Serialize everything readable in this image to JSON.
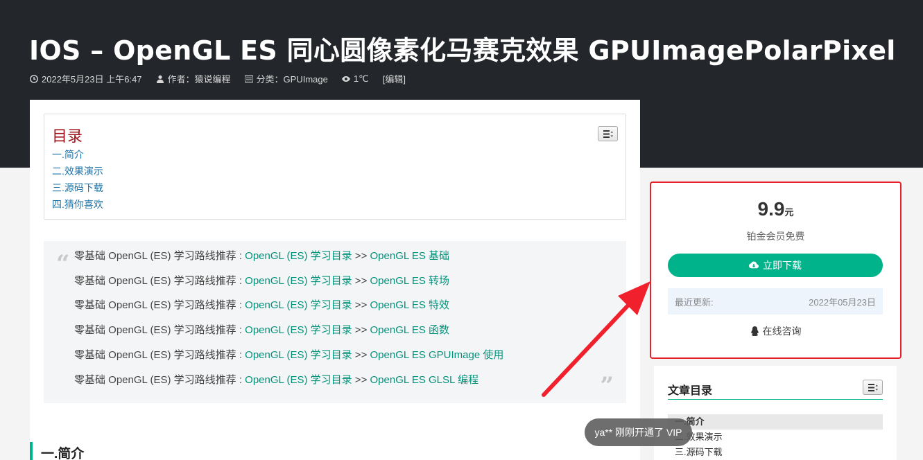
{
  "header": {
    "title": "IOS – OpenGL ES 同心圆像素化马赛克效果 GPUImagePolarPixel",
    "meta": {
      "date": "2022年5月23日 上午6:47",
      "author": "作者：猿说编程",
      "category": "分类：GPUImage",
      "views": "1℃",
      "edit": "[编辑]"
    }
  },
  "toc": {
    "title": "目录",
    "items": [
      "一.简介",
      "二.效果演示",
      "三.源码下载",
      "四.猜你喜欢"
    ]
  },
  "quote": {
    "lines": [
      {
        "prefix": "零基础 OpenGL (ES) 学习路线推荐 : ",
        "link1": "OpenGL (ES) 学习目录",
        "sep": " >> ",
        "link2": "OpenGL ES 基础"
      },
      {
        "prefix": "零基础 OpenGL (ES) 学习路线推荐 : ",
        "link1": "OpenGL (ES) 学习目录",
        "sep": " >> ",
        "link2": "OpenGL ES 转场"
      },
      {
        "prefix": "零基础 OpenGL (ES) 学习路线推荐 : ",
        "link1": "OpenGL (ES) 学习目录",
        "sep": " >> ",
        "link2": "OpenGL ES 特效"
      },
      {
        "prefix": "零基础 OpenGL (ES) 学习路线推荐 : ",
        "link1": "OpenGL (ES) 学习目录",
        "sep": " >> ",
        "link2": "OpenGL ES 函数"
      },
      {
        "prefix": "零基础 OpenGL (ES) 学习路线推荐 : ",
        "link1": "OpenGL (ES) 学习目录",
        "sep": " >> ",
        "link2": "OpenGL ES GPUImage 使用"
      },
      {
        "prefix": "零基础 OpenGL (ES) 学习路线推荐 : ",
        "link1": "OpenGL (ES) 学习目录",
        "sep": " >> ",
        "link2": "OpenGL ES GLSL 编程"
      }
    ]
  },
  "section": {
    "heading": "一.简介"
  },
  "buy": {
    "price": "9.9",
    "unit": "元",
    "member_note": "铂金会员免费",
    "download_label": "立即下载",
    "updated_label": "最近更新:",
    "updated_value": "2022年05月23日",
    "consult_label": "在线咨询"
  },
  "sidebar_toc": {
    "title": "文章目录",
    "items": [
      "一.简介",
      "二.效果演示",
      "三.源码下载"
    ]
  },
  "toast": {
    "text": "ya** 刚刚开通了 VIP"
  },
  "colors": {
    "accent": "#00b38a",
    "highlight_border": "#e8202c",
    "toc_title": "#a0141e",
    "link": "#00927a"
  }
}
